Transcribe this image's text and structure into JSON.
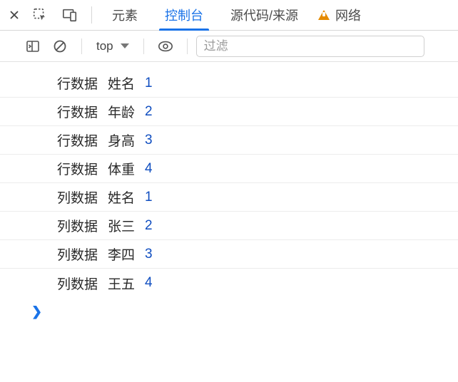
{
  "tabs": {
    "elements": "元素",
    "console": "控制台",
    "sources": "源代码/来源",
    "network": "网络"
  },
  "toolbar": {
    "context": "top",
    "filter_placeholder": "过滤"
  },
  "console_logs": [
    {
      "args": [
        "行数据",
        "姓名",
        1
      ]
    },
    {
      "args": [
        "行数据",
        "年龄",
        2
      ]
    },
    {
      "args": [
        "行数据",
        "身高",
        3
      ]
    },
    {
      "args": [
        "行数据",
        "体重",
        4
      ]
    },
    {
      "args": [
        "列数据",
        "姓名",
        1
      ]
    },
    {
      "args": [
        "列数据",
        "张三",
        2
      ]
    },
    {
      "args": [
        "列数据",
        "李四",
        3
      ]
    },
    {
      "args": [
        "列数据",
        "王五",
        4
      ]
    }
  ]
}
